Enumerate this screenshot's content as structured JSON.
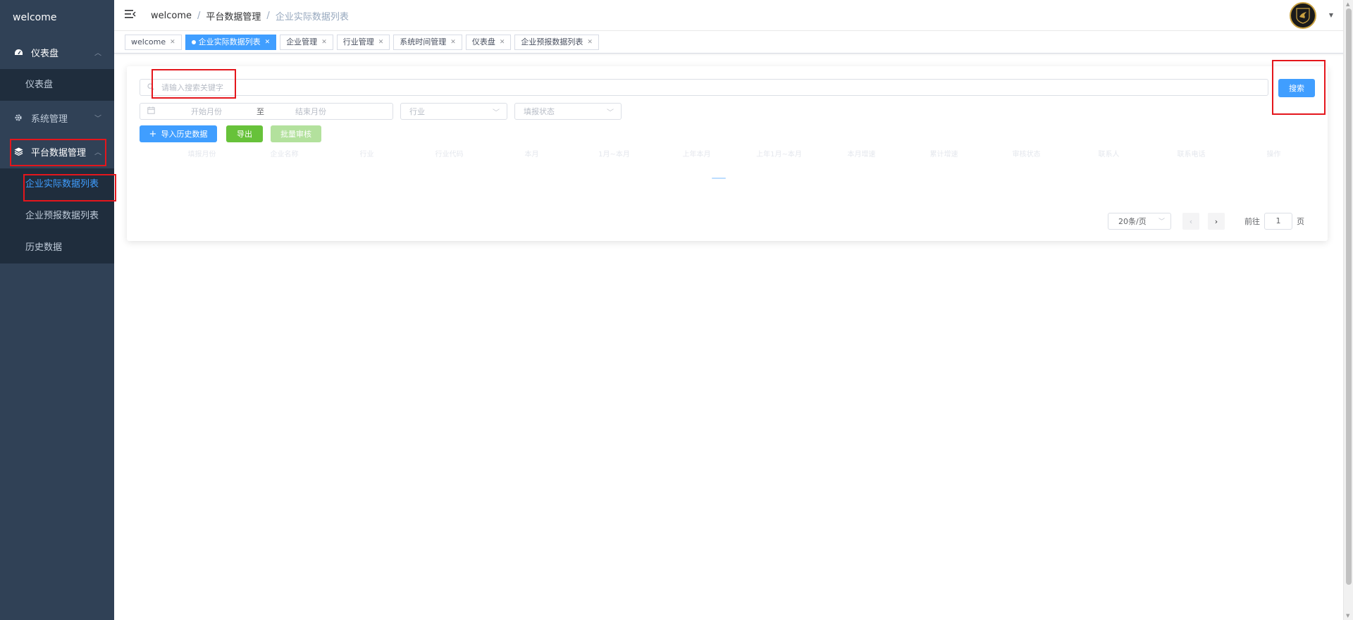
{
  "sidebar": {
    "brand": "welcome",
    "menu": [
      {
        "label": "仪表盘",
        "icon": "dashboard-icon",
        "children": [
          "仪表盘"
        ]
      },
      {
        "label": "系统管理",
        "icon": "gear-icon"
      },
      {
        "label": "平台数据管理",
        "icon": "layers-icon",
        "children": [
          "企业实际数据列表",
          "企业预报数据列表",
          "历史数据"
        ]
      }
    ]
  },
  "navbar": {
    "breadcrumb": [
      "welcome",
      "平台数据管理",
      "企业实际数据列表"
    ],
    "separator": "/"
  },
  "tags": [
    {
      "label": "welcome",
      "active": false
    },
    {
      "label": "企业实际数据列表",
      "active": true
    },
    {
      "label": "企业管理",
      "active": false
    },
    {
      "label": "行业管理",
      "active": false
    },
    {
      "label": "系统时间管理",
      "active": false
    },
    {
      "label": "仪表盘",
      "active": false
    },
    {
      "label": "企业预报数据列表",
      "active": false
    }
  ],
  "filters": {
    "search_placeholder": "请输入搜索关键字",
    "search_button": "搜索",
    "start_month": "开始月份",
    "range_separator": "至",
    "end_month": "结束月份",
    "industry_placeholder": "行业",
    "status_placeholder": "填报状态"
  },
  "actions": {
    "import": "导入历史数据",
    "export": "导出",
    "batch_audit": "批量审核"
  },
  "table": {
    "columns": [
      "填报月份",
      "企业名称",
      "行业",
      "行业代码",
      "本月",
      "1月~本月",
      "上年本月",
      "上年1月~本月",
      "本月增速",
      "累计增速",
      "审核状态",
      "联系人",
      "联系电话",
      "操作"
    ]
  },
  "pagination": {
    "page_size": "20条/页",
    "goto_label": "前往",
    "page": "1",
    "page_suffix": "页"
  },
  "colors": {
    "sidebar_bg": "#304156",
    "submenu_bg": "#1f2d3d",
    "primary": "#409eff",
    "success": "#67c23a",
    "highlight": "#e4161c"
  }
}
